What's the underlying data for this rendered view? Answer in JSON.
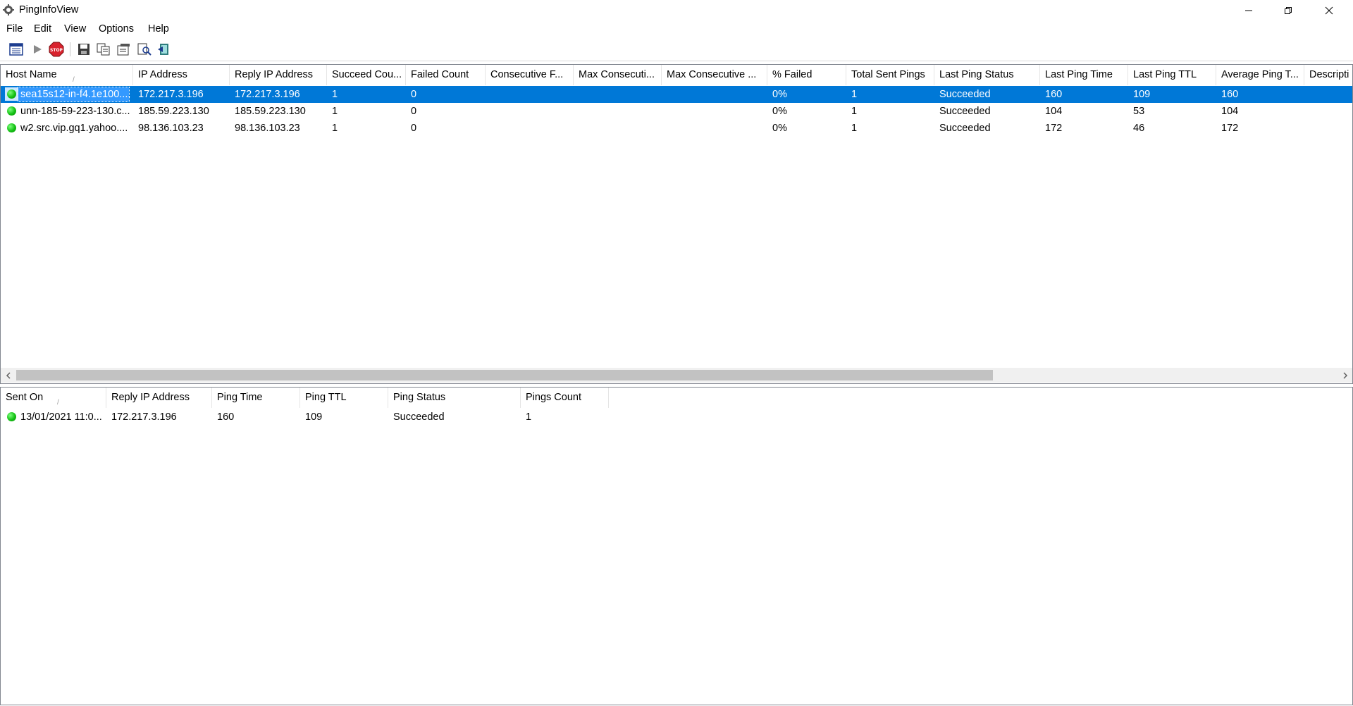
{
  "window": {
    "title": "PingInfoView"
  },
  "menu": [
    "File",
    "Edit",
    "View",
    "Options",
    "Help"
  ],
  "toolbar": [
    "select-hosts-icon",
    "start-ping-icon",
    "stop-icon",
    "save-icon",
    "copy-icon",
    "properties-icon",
    "find-icon",
    "exit-icon"
  ],
  "top_table": {
    "sort_indicator": "/",
    "columns": [
      "Host Name",
      "IP Address",
      "Reply IP Address",
      "Succeed Cou...",
      "Failed Count",
      "Consecutive F...",
      "Max Consecuti...",
      "Max Consecutive ...",
      "% Failed",
      "Total Sent Pings",
      "Last Ping Status",
      "Last Ping Time",
      "Last Ping TTL",
      "Average Ping T...",
      "Descripti"
    ],
    "rows": [
      [
        "sea15s12-in-f4.1e100....",
        "172.217.3.196",
        "172.217.3.196",
        "1",
        "0",
        "",
        "",
        "",
        "0%",
        "1",
        "Succeeded",
        "160",
        "109",
        "160",
        ""
      ],
      [
        "unn-185-59-223-130.c...",
        "185.59.223.130",
        "185.59.223.130",
        "1",
        "0",
        "",
        "",
        "",
        "0%",
        "1",
        "Succeeded",
        "104",
        "53",
        "104",
        ""
      ],
      [
        "w2.src.vip.gq1.yahoo....",
        "98.136.103.23",
        "98.136.103.23",
        "1",
        "0",
        "",
        "",
        "",
        "0%",
        "1",
        "Succeeded",
        "172",
        "46",
        "172",
        ""
      ]
    ],
    "selected_row": 0
  },
  "bottom_table": {
    "sort_indicator": "/",
    "columns": [
      "Sent On",
      "Reply IP Address",
      "Ping Time",
      "Ping TTL",
      "Ping Status",
      "Pings Count"
    ],
    "rows": [
      [
        "13/01/2021 11:0...",
        "172.217.3.196",
        "160",
        "109",
        "Succeeded",
        "1"
      ]
    ]
  },
  "colors": {
    "selection": "#0078d7",
    "status_ok": "#13c013",
    "stop_red": "#d9232e"
  }
}
